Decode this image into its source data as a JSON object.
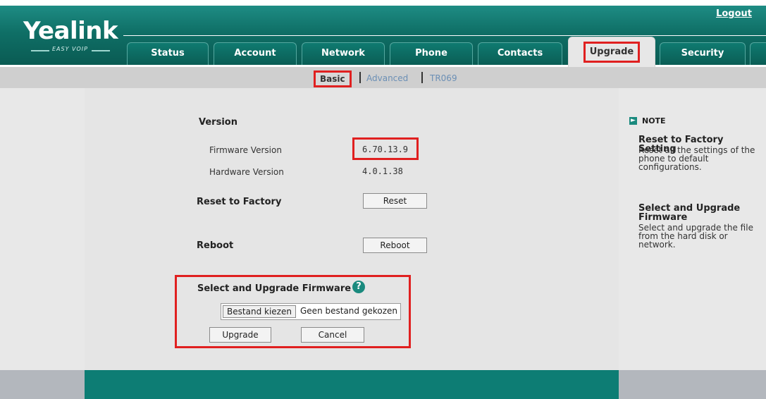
{
  "header": {
    "logo": "Yealink",
    "logo_tagline": "EASY VOIP",
    "logout": "Logout"
  },
  "tabs": [
    {
      "label": "Status"
    },
    {
      "label": "Account"
    },
    {
      "label": "Network"
    },
    {
      "label": "Phone"
    },
    {
      "label": "Contacts"
    },
    {
      "label": "Upgrade",
      "active": true
    },
    {
      "label": "Security"
    }
  ],
  "subnav": {
    "basic": "Basic",
    "advanced": "Advanced",
    "tr069": "TR069"
  },
  "version": {
    "heading": "Version",
    "firmware_label": "Firmware Version",
    "firmware_value": "6.70.13.9",
    "hardware_label": "Hardware Version",
    "hardware_value": "4.0.1.38"
  },
  "reset": {
    "label": "Reset to Factory",
    "button": "Reset"
  },
  "reboot": {
    "label": "Reboot",
    "button": "Reboot"
  },
  "firmware": {
    "heading": "Select and Upgrade Firmware",
    "help": "?",
    "choose_button": "Bestand kiezen",
    "no_file": "Geen bestand gekozen",
    "upgrade_button": "Upgrade",
    "cancel_button": "Cancel"
  },
  "note": {
    "heading": "NOTE",
    "items": [
      {
        "title": "Reset to Factory Setting",
        "text": "Reset all the settings of the phone to default configurations."
      },
      {
        "title": "Select and Upgrade Firmware",
        "text": "Select and upgrade the file from the hard disk or network."
      }
    ]
  },
  "colors": {
    "header_teal": "#0f6f66",
    "highlight_red": "#e02020",
    "link_blue": "#6b8fb5"
  }
}
